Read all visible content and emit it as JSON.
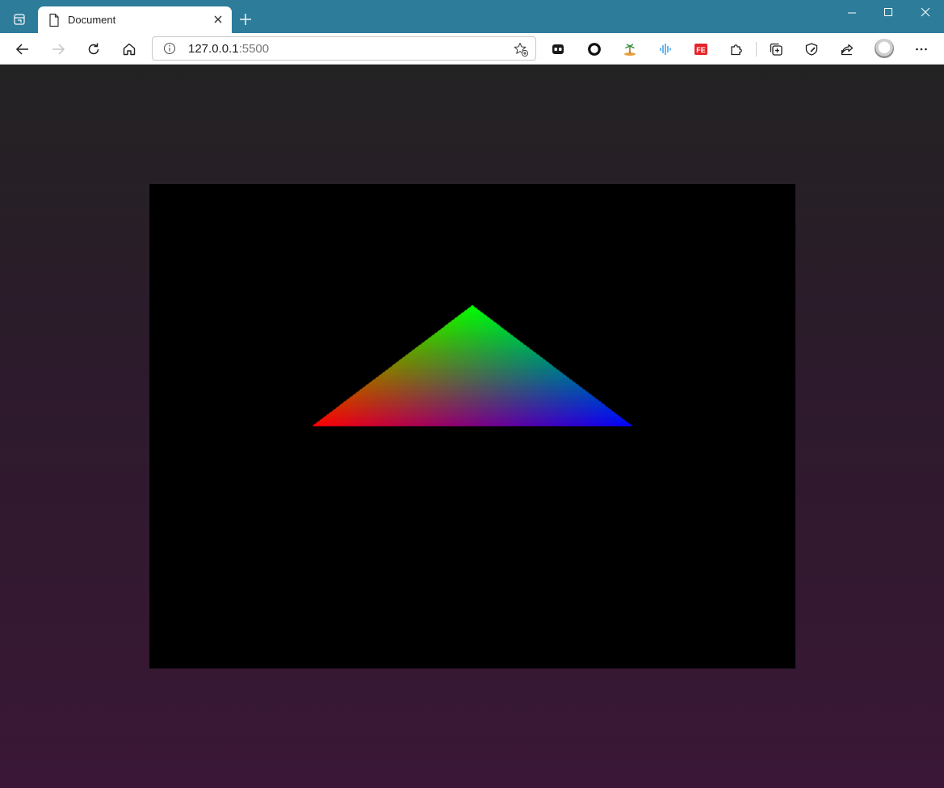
{
  "window": {
    "controls": [
      "minimize",
      "maximize",
      "close"
    ]
  },
  "tab": {
    "title": "Document",
    "favicon": "document-icon"
  },
  "address_bar": {
    "host": "127.0.0.1",
    "port": ":5500"
  },
  "toolbar": {
    "extensions": [
      "extension-dark-icon",
      "extension-circle-icon",
      "extension-island-icon",
      "extension-audio-icon",
      "extension-fe-icon",
      "extensions-puzzle-icon",
      "collections-icon",
      "performance-icon",
      "share-icon"
    ],
    "fe_label": "FE"
  },
  "canvas": {
    "background": "#000000",
    "triangle_vertex_colors": {
      "top": "#00ff00",
      "left": "#ff0000",
      "right": "#0000ff"
    }
  },
  "colors": {
    "titlebar": "#2c7c9a",
    "page_gradient_top": "#232323",
    "page_gradient_bottom": "#3a1736"
  }
}
